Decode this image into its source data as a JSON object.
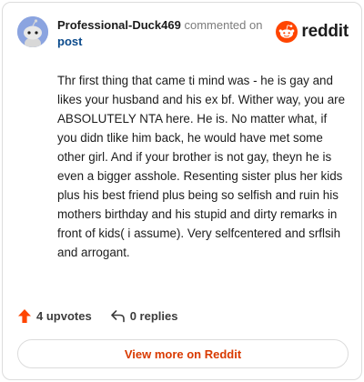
{
  "comment": {
    "username": "Professional-Duck469",
    "action_text": "commented on",
    "post_link_label": "post",
    "body": "Thr first thing that came ti mind was - he is gay and likes your husband and his ex bf. Wither way, you are ABSOLUTELY NTA here. He is. No matter what, if you didn tlike him back, he would have met some other girl. And if your brother is not gay, theyn he is even a bigger asshole. Resenting sister plus her kids plus his best friend plus being so selfish and ruin his mothers birthday and his stupid and dirty remarks in front of kids( i assume). Very selfcentered and srflsih and arrogant.",
    "upvotes_label": "4 upvotes",
    "replies_label": "0 replies"
  },
  "brand": {
    "name": "reddit",
    "accent_color": "#ff4500"
  },
  "footer": {
    "view_more_label": "View more on Reddit"
  },
  "icons": {
    "avatar": "snoo-avatar-icon",
    "logo": "reddit-logo-icon",
    "upvote": "upvote-arrow-icon",
    "reply": "reply-arrow-icon"
  }
}
